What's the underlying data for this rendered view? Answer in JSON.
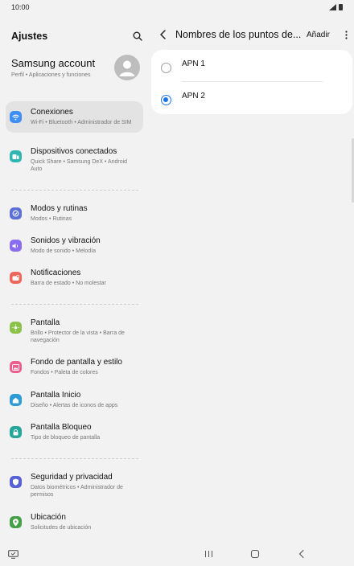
{
  "status_bar": {
    "time": "10:00"
  },
  "left": {
    "title": "Ajustes",
    "account": {
      "name": "Samsung account",
      "sub": "Perfil  •  Aplicaciones y funciones"
    },
    "items": [
      {
        "label": "Conexiones",
        "sub": "Wi-Fi  •  Bluetooth  •  Administrador de SIM",
        "icon": "wifi-icon",
        "color": "#3d8ef7",
        "active": true
      },
      {
        "label": "Dispositivos conectados",
        "sub": "Quick Share  •  Samsung DeX  •  Android Auto",
        "icon": "devices-icon",
        "color": "#2fb6b0"
      },
      {
        "label": "Modos y rutinas",
        "sub": "Modos  •  Rutinas",
        "icon": "modes-icon",
        "color": "#5b6fd8"
      },
      {
        "label": "Sonidos y vibración",
        "sub": "Modo de sonido  •  Melodía",
        "icon": "sound-icon",
        "color": "#8a6cf0"
      },
      {
        "label": "Notificaciones",
        "sub": "Barra de estado  •  No molestar",
        "icon": "notifications-icon",
        "color": "#f0665a"
      },
      {
        "label": "Pantalla",
        "sub": "Brillo  •  Protector de la vista  •  Barra de navegación",
        "icon": "display-icon",
        "color": "#8bc34a"
      },
      {
        "label": "Fondo de pantalla y estilo",
        "sub": "Fondos  •  Paleta de colores",
        "icon": "wallpaper-icon",
        "color": "#ec5f8c"
      },
      {
        "label": "Pantalla Inicio",
        "sub": "Diseño  •  Alertas de iconos de apps",
        "icon": "home-icon",
        "color": "#2c9bd6"
      },
      {
        "label": "Pantalla Bloqueo",
        "sub": "Tipo de bloqueo de pantalla",
        "icon": "lock-icon",
        "color": "#26a69a"
      },
      {
        "label": "Seguridad y privacidad",
        "sub": "Datos biométricos  •  Administrador de permisos",
        "icon": "security-icon",
        "color": "#5561d6"
      },
      {
        "label": "Ubicación",
        "sub": "Solicitudes de ubicación",
        "icon": "location-icon",
        "color": "#43a047"
      }
    ]
  },
  "right": {
    "title": "Nombres de los puntos de...",
    "add_label": "Añadir",
    "apns": [
      {
        "label": "APN 1",
        "selected": false
      },
      {
        "label": "APN 2",
        "selected": true
      }
    ]
  }
}
